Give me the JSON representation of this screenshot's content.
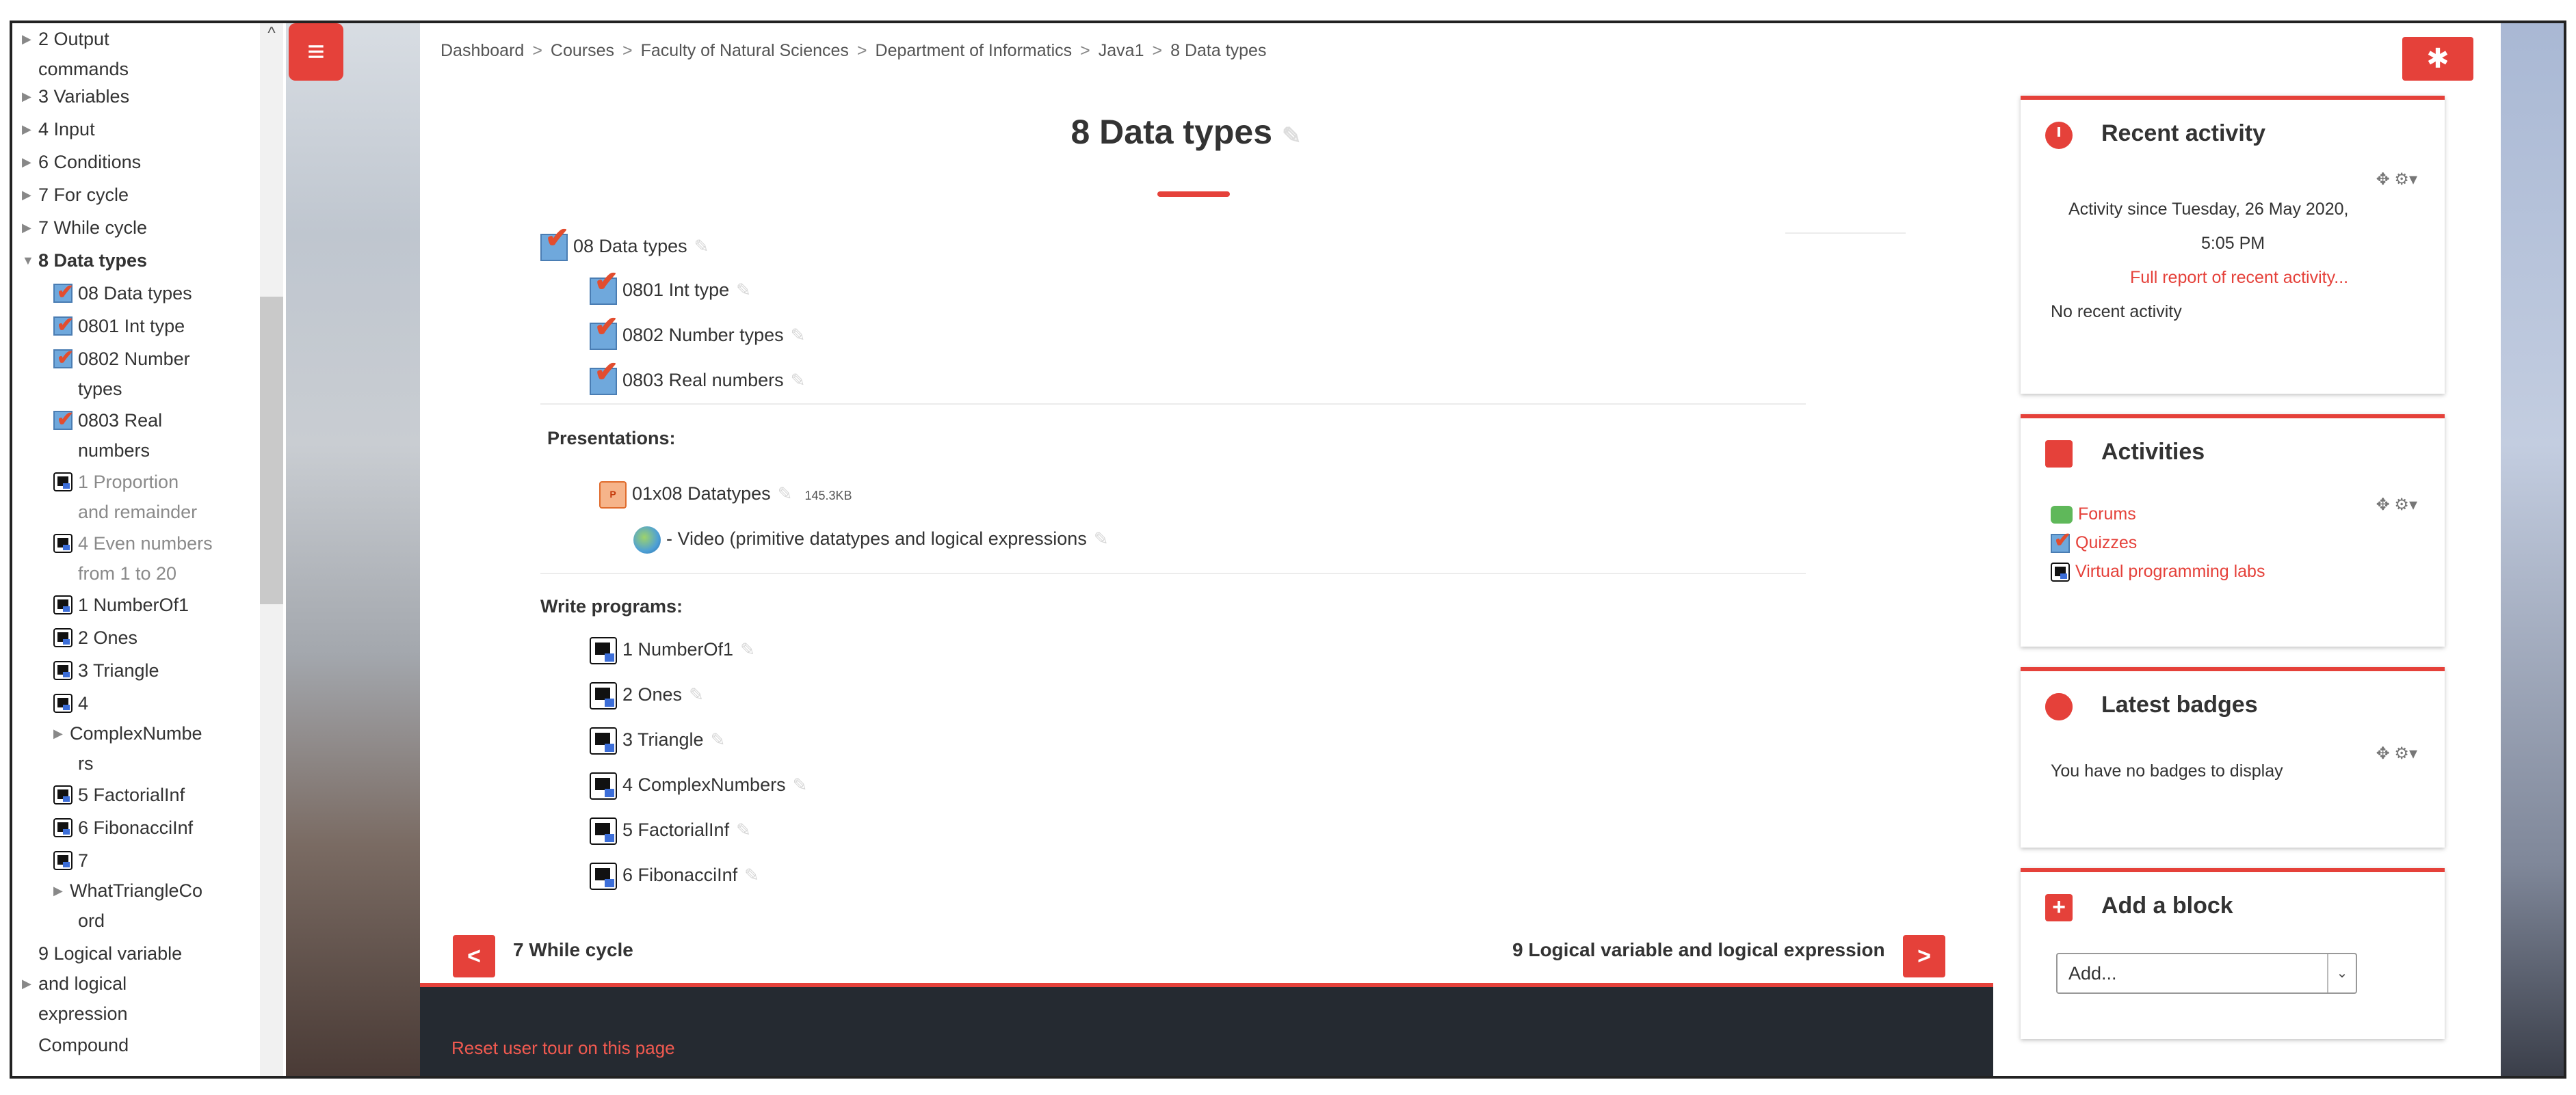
{
  "drawer": {
    "items": [
      {
        "label": "2 Output",
        "label2": "commands",
        "type": "section",
        "expanded": false
      },
      {
        "label": "3 Variables",
        "type": "section"
      },
      {
        "label": "4 Input",
        "type": "section"
      },
      {
        "label": "6 Conditions",
        "type": "section"
      },
      {
        "label": "7 For cycle",
        "type": "section"
      },
      {
        "label": "7 While cycle",
        "type": "section"
      },
      {
        "label": "8 Data types",
        "type": "section-open"
      },
      {
        "label": "08 Data types",
        "type": "quiz"
      },
      {
        "label": "0801 Int type",
        "type": "quiz"
      },
      {
        "label": "0802 Number",
        "label2": "types",
        "type": "quiz"
      },
      {
        "label": "0803 Real",
        "label2": "numbers",
        "type": "quiz"
      },
      {
        "label": "1 Proportion",
        "label2": "and remainder",
        "type": "vpl-grey"
      },
      {
        "label": "4 Even numbers",
        "label2": "from 1 to 20",
        "type": "vpl-grey"
      },
      {
        "label": "1 NumberOf1",
        "type": "vpl"
      },
      {
        "label": "2 Ones",
        "type": "vpl"
      },
      {
        "label": "3 Triangle",
        "type": "vpl"
      },
      {
        "label": "4",
        "label2": "ComplexNumbe",
        "label3": "rs",
        "type": "vpl-sub"
      },
      {
        "label": "5 FactorialInf",
        "type": "vpl"
      },
      {
        "label": "6 FibonacciInf",
        "type": "vpl"
      },
      {
        "label": "7",
        "label2": "WhatTriangleCo",
        "label3": "ord",
        "type": "vpl-sub"
      },
      {
        "label": "9 Logical variable",
        "label2": "and logical",
        "label3": "expression",
        "type": "section"
      },
      {
        "label": "Compound",
        "type": "section"
      }
    ]
  },
  "breadcrumb": [
    "Dashboard",
    "Courses",
    "Faculty of Natural Sciences",
    "Department of Informatics",
    "Java1",
    "8 Data types"
  ],
  "main": {
    "title": "8 Data types",
    "quizzes": [
      {
        "label": "08 Data types"
      },
      {
        "label": "0801 Int type"
      },
      {
        "label": "0802 Number types"
      },
      {
        "label": "0803 Real numbers"
      }
    ],
    "presentations_label": "Presentations:",
    "presentation_file": "01x08 Datatypes",
    "presentation_size": "145.3KB",
    "video_link": "- Video (primitive datatypes and logical expressions",
    "write_programs_label": "Write programs:",
    "programs": [
      "1 NumberOf1",
      "2 Ones",
      "3 Triangle",
      "4 ComplexNumbers",
      "5 FactorialInf",
      "6 FibonacciInf"
    ],
    "prev_section": "7 While cycle",
    "next_section": "9 Logical variable and logical expression"
  },
  "footer": {
    "reset_tour": "Reset user tour on this page"
  },
  "blocks": {
    "recent": {
      "title": "Recent activity",
      "since_line1": "Activity since Tuesday, 26 May 2020,",
      "since_line2": "5:05 PM",
      "full_report": "Full report of recent activity...",
      "none": "No recent activity"
    },
    "activities": {
      "title": "Activities",
      "links": [
        "Forums",
        "Quizzes",
        "Virtual programming labs"
      ]
    },
    "badges": {
      "title": "Latest badges",
      "none": "You have no badges to display"
    },
    "add": {
      "title": "Add a block",
      "select_value": "Add..."
    }
  },
  "icons": {
    "drawer_toggle": "hamburger-icon",
    "settings": "gear-icon",
    "prev": "chevron-left-icon",
    "next": "chevron-right-icon"
  },
  "colors": {
    "accent": "#e5413a",
    "footer": "#252a31"
  }
}
